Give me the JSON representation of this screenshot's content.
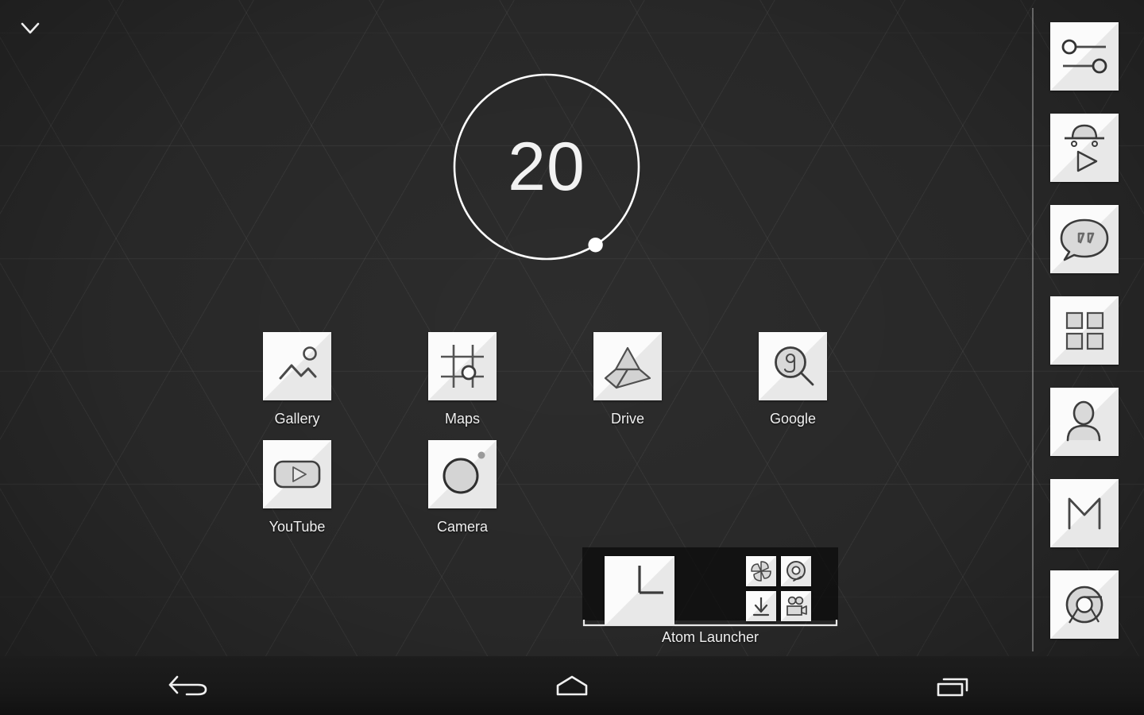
{
  "wallpaper": {
    "background_color": "#282828",
    "pattern": "triangular-lattice",
    "line_color": "#3a3a3a"
  },
  "statusbar": {
    "chevron_icon": "chevron-down-icon"
  },
  "clock_widget": {
    "value": "20",
    "unit_hint": "minutes",
    "ring_color": "#ffffff",
    "dot_angle_degrees": 58,
    "text_color": "#f2f2f2"
  },
  "home_screen": {
    "rows": [
      {
        "apps": [
          {
            "label": "Gallery",
            "icon": "gallery-icon"
          },
          {
            "label": "Maps",
            "icon": "maps-icon"
          },
          {
            "label": "Drive",
            "icon": "drive-icon"
          },
          {
            "label": "Google",
            "icon": "google-search-icon"
          }
        ]
      },
      {
        "apps": [
          {
            "label": "YouTube",
            "icon": "youtube-icon"
          },
          {
            "label": "Camera",
            "icon": "camera-icon"
          }
        ]
      }
    ]
  },
  "folder": {
    "label": "Atom Launcher",
    "primary_icon": "clock-icon",
    "mini_icons": [
      {
        "name": "photos-pinwheel-icon"
      },
      {
        "name": "camera-lens-icon"
      },
      {
        "name": "download-arrow-icon"
      },
      {
        "name": "movie-camera-icon"
      }
    ],
    "background_color": "#0a0a0a"
  },
  "dock": {
    "divider_color": "#4d4d4d",
    "items": [
      {
        "label": "Settings",
        "icon": "settings-sliders-icon"
      },
      {
        "label": "Play Store",
        "icon": "play-store-bag-icon"
      },
      {
        "label": "Messaging",
        "icon": "speech-bubble-quote-icon"
      },
      {
        "label": "Apps",
        "icon": "apps-grid-icon"
      },
      {
        "label": "Contacts",
        "icon": "person-icon"
      },
      {
        "label": "Gmail",
        "icon": "gmail-m-icon"
      },
      {
        "label": "Chrome",
        "icon": "chrome-icon"
      }
    ]
  },
  "navbar": {
    "buttons": [
      {
        "label": "Back",
        "icon": "back-arrow-icon"
      },
      {
        "label": "Home",
        "icon": "home-icon"
      },
      {
        "label": "Recents",
        "icon": "recents-icon"
      }
    ],
    "background_color": "#181818"
  }
}
